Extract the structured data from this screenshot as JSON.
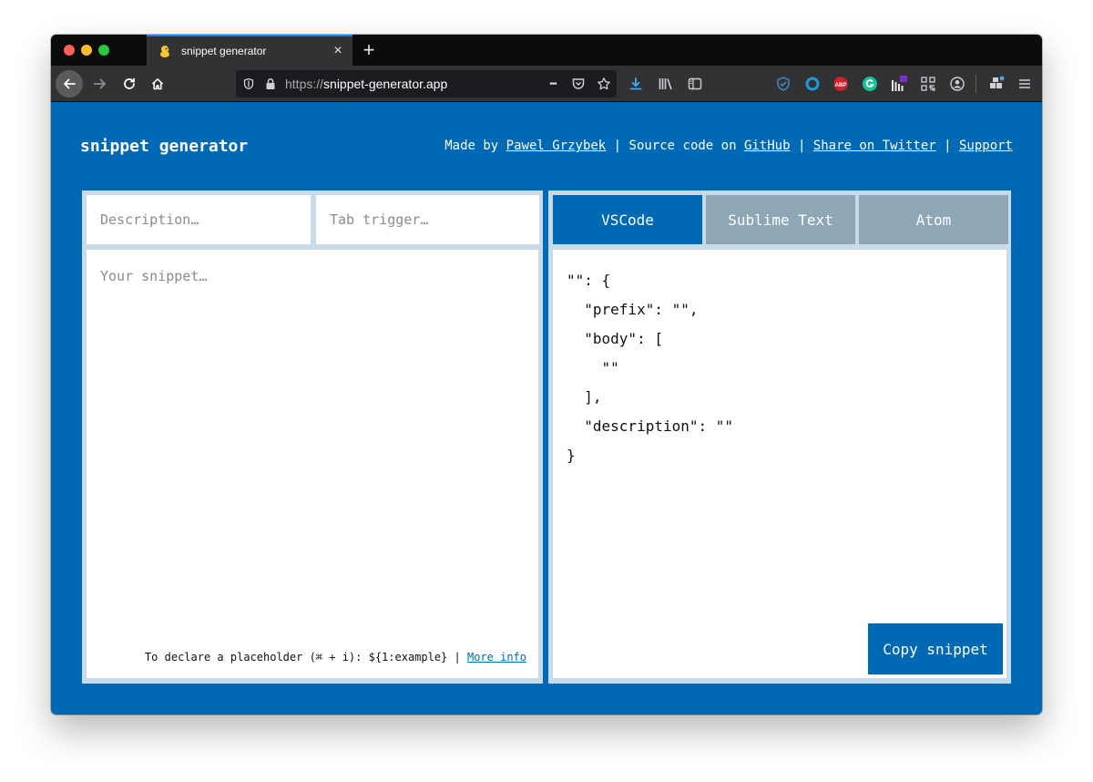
{
  "browser": {
    "tab_title": "snippet generator",
    "tab_close": "×",
    "new_tab": "+",
    "url_scheme": "https://",
    "url_host": "snippet-generator.app",
    "url_more": "•••"
  },
  "header": {
    "brand": "snippet generator",
    "made_by": "Made by ",
    "author": "Pawel Grzybek",
    "sep1": " | Source code on ",
    "github": "GitHub",
    "sep2": " | ",
    "twitter": "Share on Twitter",
    "sep3": " | ",
    "support": "Support"
  },
  "form": {
    "description_placeholder": "Description…",
    "trigger_placeholder": "Tab trigger…",
    "snippet_placeholder": "Your snippet…",
    "hint_text": "To declare a placeholder (⌘ + i): ${1:example} | ",
    "hint_link": "More info"
  },
  "editors": {
    "tabs": [
      "VSCode",
      "Sublime Text",
      "Atom"
    ],
    "active": "VSCode"
  },
  "output": {
    "code": "\"\": {\n  \"prefix\": \"\",\n  \"body\": [\n    \"\"\n  ],\n  \"description\": \"\"\n}"
  },
  "actions": {
    "copy_label": "Copy snippet"
  },
  "colors": {
    "page_bg": "#0069b5",
    "inactive_tab": "#8fa6b7",
    "panel_border": "#c7dbea"
  }
}
